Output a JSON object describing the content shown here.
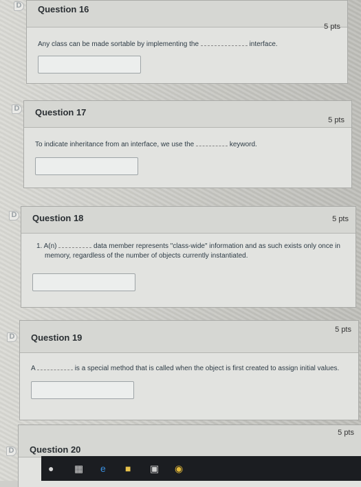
{
  "questions": [
    {
      "title": "Question 16",
      "points": "5 pts",
      "text_before": "Any class can be made sortable by implementing the",
      "text_after": "interface."
    },
    {
      "title": "Question 17",
      "points": "5 pts",
      "text_before": "To indicate inheritance from an interface, we use the",
      "text_after": "keyword."
    },
    {
      "title": "Question 18",
      "points": "5 pts",
      "text_before": "1. A(n)",
      "text_after": "data member represents \"class-wide\" information and as such exists only once in",
      "text_line2": "memory, regardless of the number of objects currently instantiated."
    },
    {
      "title": "Question 19",
      "points": "5 pts",
      "text_before": "A",
      "text_after": "is a special method that is called when the object is first created to assign initial values."
    },
    {
      "title": "Question 20",
      "points": "5 pts"
    }
  ],
  "flag_glyph": "D",
  "taskbar_icons": [
    "microphone-icon",
    "task-view-icon",
    "edge-browser-icon",
    "file-explorer-icon",
    "store-icon",
    "chrome-icon"
  ]
}
